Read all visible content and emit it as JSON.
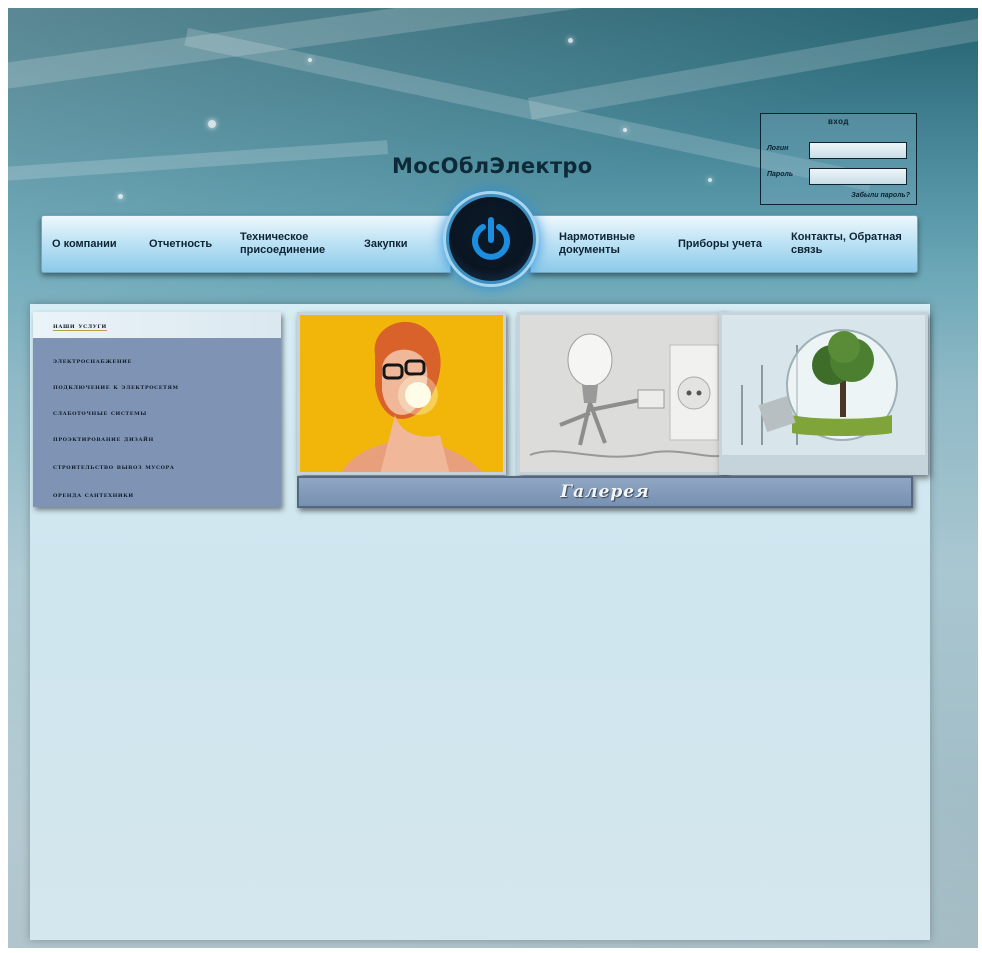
{
  "header": {
    "site_title": "МосОблЭлектро"
  },
  "login": {
    "title": "вход",
    "login_label": "Логин",
    "password_label": "Пароль",
    "forgot_link": "Забыли пароль?"
  },
  "nav": {
    "left": [
      {
        "label": "О компании"
      },
      {
        "label": "Отчетность"
      },
      {
        "label": "Техническое присоединение"
      },
      {
        "label": "Закупки"
      }
    ],
    "right": [
      {
        "label": "Нармотивные документы"
      },
      {
        "label": "Приборы учета"
      },
      {
        "label": "Контакты, Обратная связь"
      }
    ]
  },
  "sidebar": {
    "title": "наши услуги",
    "items": [
      {
        "label": "электроснабжение"
      },
      {
        "label": "подключение к электросетям"
      },
      {
        "label": "слаботочные системы"
      },
      {
        "label": "проэктирование дизайн"
      },
      {
        "label": "строительство вывоз мусора"
      },
      {
        "label": "оренда сантехники"
      }
    ]
  },
  "gallery": {
    "label": "Галерея"
  },
  "colors": {
    "nav_gradient_top": "#eef8fd",
    "nav_gradient_bottom": "#8ccae9",
    "power_ring": "#3c8ec0",
    "sidebar_bg": "#7f94b4",
    "gallery_bar": "#7890b2",
    "content_bg": "#d7edf5"
  },
  "icons": {
    "power": "power-icon"
  }
}
